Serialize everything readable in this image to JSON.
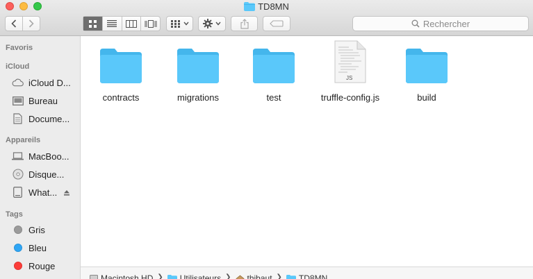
{
  "window": {
    "title": "TD8MN"
  },
  "toolbar": {
    "back_icon": "chevron-left-icon",
    "forward_icon": "chevron-right-icon",
    "view_modes": [
      "icon-view",
      "list-view",
      "column-view",
      "cover-flow-view"
    ],
    "active_view": "icon-view",
    "arrange_icon": "arrange-grid-icon",
    "action_icon": "gear-icon",
    "share_icon": "share-icon",
    "tag_icon": "tag-icon"
  },
  "search": {
    "placeholder": "Rechercher"
  },
  "sidebar": {
    "favorites_heading": "Favoris",
    "icloud_heading": "iCloud",
    "icloud_items": [
      {
        "label": "iCloud D...",
        "icon": "cloud-icon"
      },
      {
        "label": "Bureau",
        "icon": "desktop-icon"
      },
      {
        "label": "Docume...",
        "icon": "document-icon"
      }
    ],
    "devices_heading": "Appareils",
    "devices": [
      {
        "label": "MacBoo...",
        "icon": "laptop-icon"
      },
      {
        "label": "Disque...",
        "icon": "disc-icon"
      },
      {
        "label": "What...",
        "icon": "drive-icon",
        "eject": true
      }
    ],
    "tags_heading": "Tags",
    "tags": [
      {
        "label": "Gris",
        "color": "#9b9b9b"
      },
      {
        "label": "Bleu",
        "color": "#2fa6f5"
      },
      {
        "label": "Rouge",
        "color": "#fc3d39"
      }
    ]
  },
  "files": [
    {
      "name": "contracts",
      "kind": "folder"
    },
    {
      "name": "migrations",
      "kind": "folder"
    },
    {
      "name": "test",
      "kind": "folder"
    },
    {
      "name": "truffle-config.js",
      "kind": "js-file",
      "badge": "JS"
    },
    {
      "name": "build",
      "kind": "folder"
    }
  ],
  "path": [
    {
      "label": "Macintosh HD",
      "icon": "hard-drive-icon"
    },
    {
      "label": "Utilisateurs",
      "icon": "folder-icon"
    },
    {
      "label": "thibaut",
      "icon": "home-icon"
    },
    {
      "label": "TD8MN",
      "icon": "folder-icon"
    }
  ],
  "colors": {
    "folder": "#5ac8fa",
    "folder_dark": "#44b6ec",
    "active_segment": "#6e6e6e"
  }
}
